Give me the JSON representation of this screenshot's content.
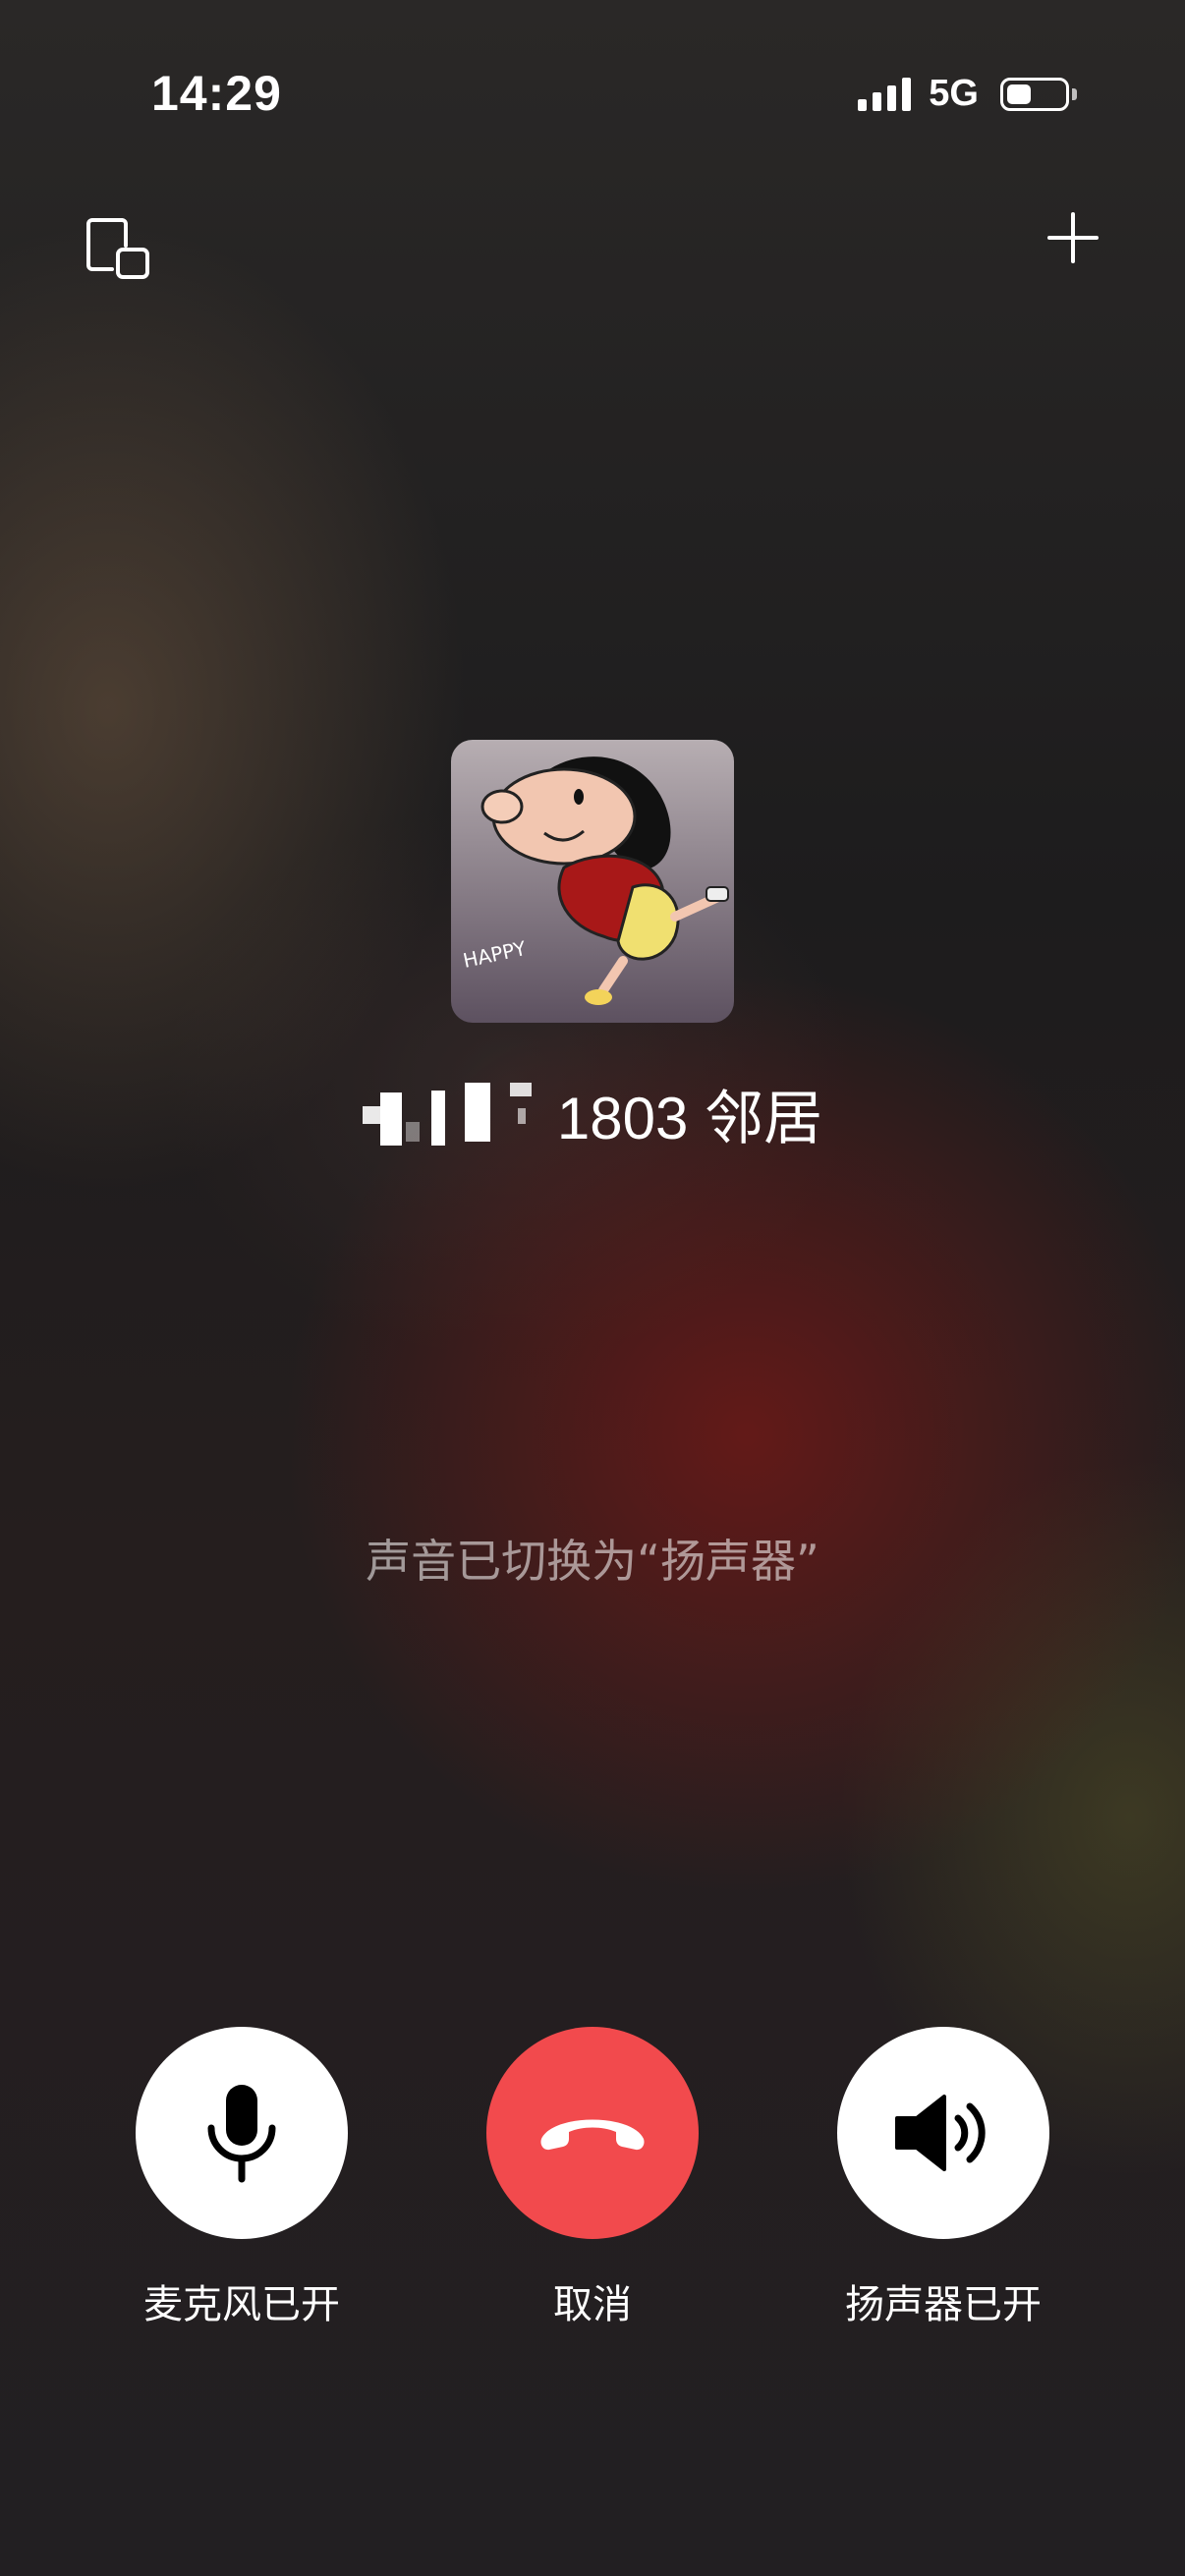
{
  "status_bar": {
    "time": "14:29",
    "network": "5G"
  },
  "top_bar": {
    "left_icon": "floating-window-icon",
    "right_icon": "plus-icon"
  },
  "caller": {
    "avatar_caption": "HAPPY",
    "name": "1803 邻居"
  },
  "notice": "声音已切换为“扬声器”",
  "controls": [
    {
      "icon": "microphone-icon",
      "label": "麦克风已开"
    },
    {
      "icon": "phone-hangup-icon",
      "label": "取消",
      "color": "#f24a4d"
    },
    {
      "icon": "speaker-icon",
      "label": "扬声器已开"
    }
  ]
}
